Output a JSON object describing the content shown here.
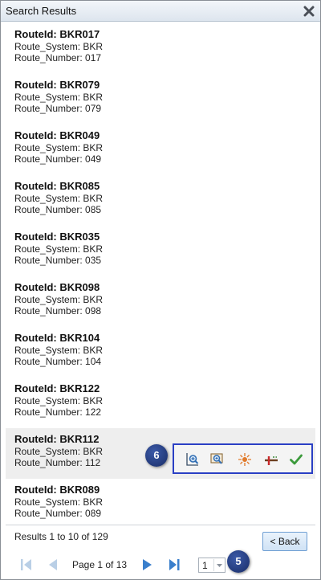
{
  "window": {
    "title": "Search Results"
  },
  "results": [
    {
      "route_id": "RouteId: BKR017",
      "route_system": "Route_System: BKR",
      "route_number": "Route_Number: 017"
    },
    {
      "route_id": "RouteId: BKR079",
      "route_system": "Route_System: BKR",
      "route_number": "Route_Number: 079"
    },
    {
      "route_id": "RouteId: BKR049",
      "route_system": "Route_System: BKR",
      "route_number": "Route_Number: 049"
    },
    {
      "route_id": "RouteId: BKR085",
      "route_system": "Route_System: BKR",
      "route_number": "Route_Number: 085"
    },
    {
      "route_id": "RouteId: BKR035",
      "route_system": "Route_System: BKR",
      "route_number": "Route_Number: 035"
    },
    {
      "route_id": "RouteId: BKR098",
      "route_system": "Route_System: BKR",
      "route_number": "Route_Number: 098"
    },
    {
      "route_id": "RouteId: BKR104",
      "route_system": "Route_System: BKR",
      "route_number": "Route_Number: 104"
    },
    {
      "route_id": "RouteId: BKR122",
      "route_system": "Route_System: BKR",
      "route_number": "Route_Number: 122"
    },
    {
      "route_id": "RouteId: BKR112",
      "route_system": "Route_System: BKR",
      "route_number": "Route_Number: 112"
    },
    {
      "route_id": "RouteId: BKR089",
      "route_system": "Route_System: BKR",
      "route_number": "Route_Number: 089"
    }
  ],
  "selected_index": 8,
  "row_toolbar": {
    "icons": [
      "zoom-to-feature-icon",
      "zoom-to-extent-icon",
      "flash-feature-icon",
      "set-measure-icon",
      "checkmark-icon"
    ]
  },
  "callouts": {
    "toolbar": "6",
    "page_select": "5"
  },
  "footer": {
    "summary": "Results 1 to 10 of 129",
    "back_label": "< Back",
    "page_label": "Page 1 of 13",
    "page_select_value": "1"
  },
  "colors": {
    "callout_border": "#2a3fc4",
    "selected_row": "#eeeeee",
    "accent": "#4a86c5"
  }
}
